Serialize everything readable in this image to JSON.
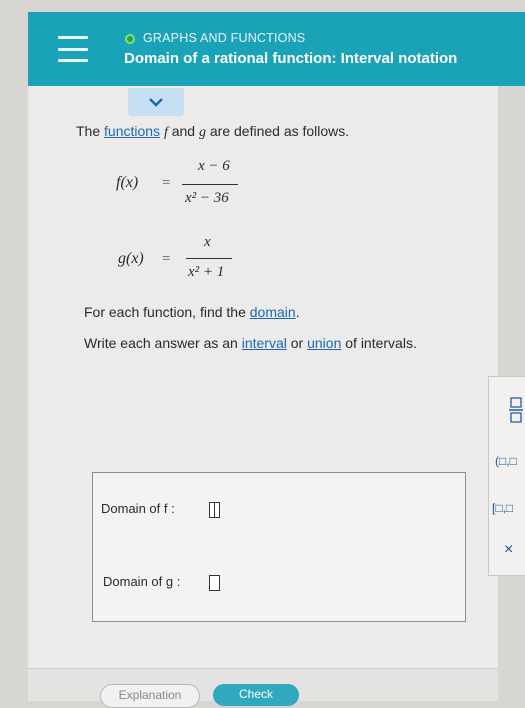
{
  "header": {
    "section": "GRAPHS AND FUNCTIONS",
    "topic": "Domain of a rational function: Interval notation"
  },
  "problem": {
    "intro_prefix": "The",
    "intro_link": "functions",
    "intro_f": "f",
    "intro_middle": "and",
    "intro_g": "g",
    "intro_suffix": "are defined as follows.",
    "f_label": "f(x)",
    "f_equals": "=",
    "f_numerator": "x − 6",
    "f_denominator": "x² − 36",
    "g_label": "g(x)",
    "g_equals": "=",
    "g_numerator": "x",
    "g_denominator": "x² + 1",
    "instruction1_prefix": "For each function, find the",
    "instruction1_link": "domain",
    "instruction1_suffix": ".",
    "instruction2_prefix": "Write each answer as an",
    "instruction2_link1": "interval",
    "instruction2_middle": "or",
    "instruction2_link2": "union",
    "instruction2_suffix": "of intervals."
  },
  "answers": {
    "domain_f_label": "Domain of f :",
    "domain_g_label": "Domain of g :"
  },
  "tools": {
    "open_closed": "(□,□",
    "closed_closed": "[□,□",
    "close": "×"
  },
  "footer": {
    "explanation": "Explanation",
    "check": "Check"
  },
  "colors": {
    "header_bg": "#1aa3b8",
    "link": "#1a68b7",
    "check_bg": "#2ea9c0"
  }
}
